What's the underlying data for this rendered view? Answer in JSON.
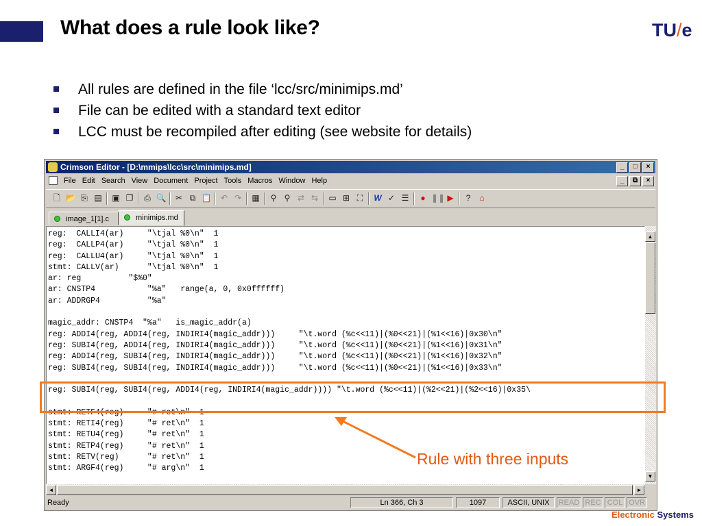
{
  "slide": {
    "title": "What does a rule look like?",
    "logo": {
      "left": "TU",
      "slash": "/",
      "right": "e"
    },
    "bullets": [
      "All rules are defined in the file ‘lcc/src/minimips.md’",
      "File can be edited with a standard text editor",
      "LCC must be recompiled after editing  (see website for details)"
    ],
    "callout": "Rule with three inputs",
    "footer": {
      "word1": "Electronic",
      "word2": "Systems"
    },
    "colors": {
      "accent": "#e35a12",
      "brand": "#1a1f6e",
      "highlight": "#f27b22"
    }
  },
  "window": {
    "title": "Crimson Editor - [D:\\mmips\\lcc\\src\\minimips.md]",
    "caption_buttons": [
      "_",
      "□",
      "×"
    ],
    "mdi_buttons": [
      "_",
      "⧉",
      "×"
    ],
    "menu": [
      "File",
      "Edit",
      "Search",
      "View",
      "Document",
      "Project",
      "Tools",
      "Macros",
      "Window",
      "Help"
    ],
    "tabs": [
      "image_1[1].c",
      "minimips.md"
    ],
    "active_tab": "minimips.md",
    "toolbar_icons": [
      "new-file-icon",
      "open-file-icon",
      "open-project-icon",
      "folder-icon",
      "save-icon",
      "save-all-icon",
      "print-icon",
      "print-preview-icon",
      "cut-icon",
      "copy-icon",
      "paste-icon",
      "undo-icon",
      "redo-icon",
      "column-mode-icon",
      "find-icon",
      "find-next-icon",
      "replace-icon",
      "replace-all-icon",
      "window-icon",
      "window-tile-icon",
      "fullscreen-icon",
      "word-wrap-icon",
      "spell-check-icon",
      "line-numbers-icon",
      "record-macro-icon",
      "pause-macro-icon",
      "play-macro-icon",
      "help-icon",
      "home-icon"
    ],
    "code_lines": [
      "reg:  CALLI4(ar)     \"\\tjal %0\\n\"  1",
      "reg:  CALLP4(ar)     \"\\tjal %0\\n\"  1",
      "reg:  CALLU4(ar)     \"\\tjal %0\\n\"  1",
      "stmt: CALLV(ar)      \"\\tjal %0\\n\"  1",
      "ar: reg          \"$%0\"",
      "ar: CNSTP4           \"%a\"   range(a, 0, 0x0ffffff)",
      "ar: ADDRGP4          \"%a\"",
      "",
      "magic_addr: CNSTP4  \"%a\"   is_magic_addr(a)",
      "reg: ADDI4(reg, ADDI4(reg, INDIRI4(magic_addr)))     \"\\t.word (%c<<11)|(%0<<21)|(%1<<16)|0x30\\n\"",
      "reg: SUBI4(reg, ADDI4(reg, INDIRI4(magic_addr)))     \"\\t.word (%c<<11)|(%0<<21)|(%1<<16)|0x31\\n\"",
      "reg: ADDI4(reg, SUBI4(reg, INDIRI4(magic_addr)))     \"\\t.word (%c<<11)|(%0<<21)|(%1<<16)|0x32\\n\"",
      "reg: SUBI4(reg, SUBI4(reg, INDIRI4(magic_addr)))     \"\\t.word (%c<<11)|(%0<<21)|(%1<<16)|0x33\\n\"",
      "",
      "reg: SUBI4(reg, SUBI4(reg, ADDI4(reg, INDIRI4(magic_addr)))) \"\\t.word (%c<<11)|(%2<<21)|(%2<<16)|0x35\\",
      "",
      "stmt: RETF4(reg)     \"# ret\\n\"  1",
      "stmt: RETI4(reg)     \"# ret\\n\"  1",
      "stmt: RETU4(reg)     \"# ret\\n\"  1",
      "stmt: RETP4(reg)     \"# ret\\n\"  1",
      "stmt: RETV(reg)      \"# ret\\n\"  1",
      "stmt: ARGF4(reg)     \"# arg\\n\"  1"
    ],
    "status": {
      "ready": "Ready",
      "position": "Ln 366,  Ch 3",
      "size": "1097",
      "encoding": "ASCII, UNIX",
      "read": "READ",
      "rec": "REC",
      "col": "COL",
      "ovr": "OVR"
    },
    "scroll_arrows": {
      "up": "▲",
      "down": "▼",
      "left": "◄",
      "right": "►"
    }
  }
}
